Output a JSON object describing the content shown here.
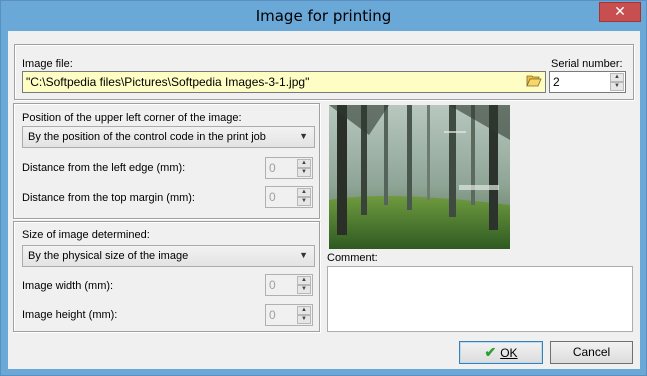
{
  "window": {
    "title": "Image for printing",
    "close_glyph": "✕"
  },
  "image_file": {
    "label": "Image file:",
    "value": "\"C:\\Softpedia files\\Pictures\\Softpedia Images-3-1.jpg\"",
    "browse_icon": "open-folder-icon"
  },
  "serial": {
    "label": "Serial number:",
    "value": "2"
  },
  "position": {
    "label": "Position of the upper left corner of the image:",
    "selected": "By the position of the control code in the print job",
    "left_label": "Distance from the left edge (mm):",
    "left_value": "0",
    "top_label": "Distance from the top margin (mm):",
    "top_value": "0"
  },
  "size": {
    "label": "Size of image determined:",
    "selected": "By the physical size of the image",
    "width_label": "Image width (mm):",
    "width_value": "0",
    "height_label": "Image height (mm):",
    "height_value": "0"
  },
  "comment": {
    "label": "Comment:",
    "value": ""
  },
  "buttons": {
    "ok": "OK",
    "cancel": "Cancel"
  },
  "colors": {
    "title_bar": "#6aa8d8",
    "close_button": "#c74f4f",
    "file_field_bg": "#fdfdc4",
    "ok_check": "#2ea12e"
  }
}
